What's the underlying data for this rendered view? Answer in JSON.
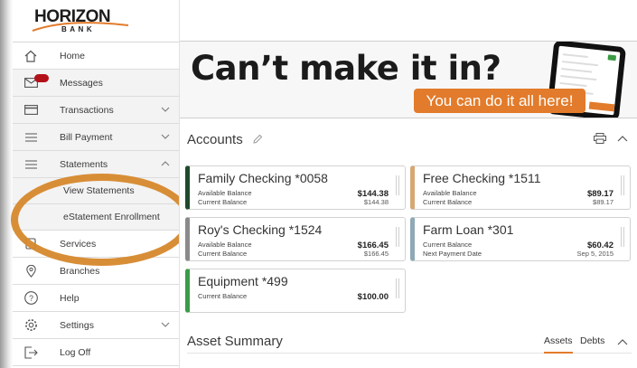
{
  "brand": {
    "name": "HORIZON",
    "sub": "BANK"
  },
  "nav": {
    "home": "Home",
    "messages": "Messages",
    "transactions": "Transactions",
    "bill_payment": "Bill Payment",
    "statements": "Statements",
    "view_statements": "View Statements",
    "estatement": "eStatement Enrollment",
    "services": "Services",
    "branches": "Branches",
    "help": "Help",
    "settings": "Settings",
    "logoff": "Log Off"
  },
  "banner": {
    "headline": "Can’t make it in?",
    "cta": "You can do it all here!"
  },
  "accounts": {
    "title": "Accounts",
    "cards": [
      {
        "name": "Family Checking *0058",
        "l1": "Available Balance",
        "v1": "$144.38",
        "l2": "Current Balance",
        "v2": "$144.38",
        "color": "#1e4a2a"
      },
      {
        "name": "Free Checking *1511",
        "l1": "Available Balance",
        "v1": "$89.17",
        "l2": "Current Balance",
        "v2": "$89.17",
        "color": "#d6a874"
      },
      {
        "name": "Roy's Checking *1524",
        "l1": "Available Balance",
        "v1": "$166.45",
        "l2": "Current Balance",
        "v2": "$166.45",
        "color": "#8a8a8a"
      },
      {
        "name": "Farm Loan *301",
        "l1": "Current Balance",
        "v1": "$60.42",
        "l2": "Next Payment Date",
        "v2": "Sep 5, 2015",
        "color": "#8fa9b5"
      },
      {
        "name": "Equipment *499",
        "l1": "Current Balance",
        "v1": "$100.00",
        "color": "#3b9b47"
      }
    ]
  },
  "assets": {
    "title": "Asset Summary",
    "tab_assets": "Assets",
    "tab_debts": "Debts"
  },
  "colors": {
    "accent": "#e27b2b",
    "badge": "#b3111a"
  }
}
